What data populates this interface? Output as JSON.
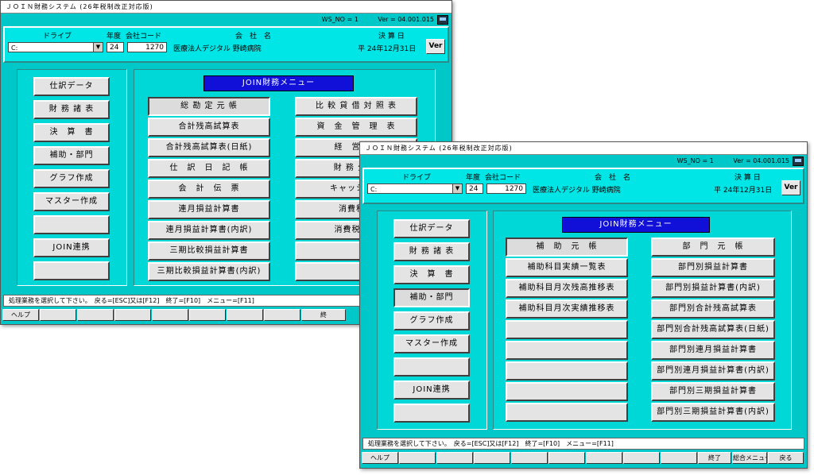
{
  "back": {
    "title": "ＪＯＩＮ財務システム (26年税制改正対応版)",
    "ws_no": "WS_NO = 1",
    "version": "Ver = 04.001.015",
    "header": {
      "drive_label": "ドライブ",
      "year_label": "年度",
      "company_code_label": "会社コード",
      "company_label": "会　社　名",
      "closing_label": "決 算 日",
      "drive_value": "C:",
      "year_value": "24",
      "company_code": "1270",
      "company_name": "医療法人デジタル 野崎病院",
      "closing_date": "平 24年12月31日",
      "ver_button": "Ver"
    },
    "side_buttons": [
      "仕訳データ",
      "財 務 諸 表",
      "決　算　書",
      "補助・部門",
      "グラフ作成",
      "マスター作成",
      "",
      "JOIN連携",
      ""
    ],
    "menu_title": "JOIN財務メニュー",
    "menu_col1": [
      "総 勘 定 元 帳",
      "合計残高試算表",
      "合計残高試算表(日紙)",
      "仕　訳　日　記　帳",
      "会　計　伝　票",
      "連月損益計算書",
      "連月損益計算書(内訳)",
      "三期比較損益計算書",
      "三期比較損益計算書(内訳)"
    ],
    "menu_col2": [
      "比 較 貸 借 対 照 表",
      "資　金　管　理　表",
      "経　営　分",
      "財 務 分 析",
      "キャッシュフ",
      "消費税額",
      "消費税区分",
      "",
      ""
    ],
    "status": "処理業務を選択して下さい。　戻る=[ESC]又は[F12]　終了=[F10]　メニュー=[F11]",
    "fkeys": [
      "ヘルプ",
      "",
      "",
      "",
      "",
      "",
      "",
      "",
      "終"
    ]
  },
  "front": {
    "title": "ＪＯＩＮ財務システム (26年税制改正対応版)",
    "ws_no": "WS_NO = 1",
    "version": "Ver = 04.001.015",
    "header": {
      "drive_label": "ドライブ",
      "year_label": "年度",
      "company_code_label": "会社コード",
      "company_label": "会　社　名",
      "closing_label": "決 算 日",
      "drive_value": "C:",
      "year_value": "24",
      "company_code": "1270",
      "company_name": "医療法人デジタル 野崎病院",
      "closing_date": "平 24年12月31日",
      "ver_button": "Ver"
    },
    "side_buttons": [
      "仕訳データ",
      "財 務 諸 表",
      "決　算　書",
      "補助・部門",
      "グラフ作成",
      "マスター作成",
      "",
      "JOIN連携",
      ""
    ],
    "menu_title": "JOIN財務メニュー",
    "menu_col1": [
      "補　助　元　帳",
      "補助科目実績一覧表",
      "補助科目月次残高推移表",
      "補助科目月次実績推移表",
      "",
      "",
      "",
      "",
      ""
    ],
    "menu_col2": [
      "部　門　元　帳",
      "部門別損益計算書",
      "部門別損益計算書(内訳)",
      "部門別合計残高試算表",
      "部門別合計残高試算表(日紙)",
      "部門別連月損益計算書",
      "部門別連月損益計算書(内訳)",
      "部門別三期損益計算書",
      "部門別三期損益計算書(内訳)"
    ],
    "status": "処理業務を選択して下さい。　戻る=[ESC]又は[F12]　終了=[F10]　メニュー=[F11]",
    "fkeys": [
      "ヘルプ",
      "",
      "",
      "",
      "",
      "",
      "",
      "",
      "",
      "終了",
      "総合メニュー",
      "戻る"
    ]
  }
}
